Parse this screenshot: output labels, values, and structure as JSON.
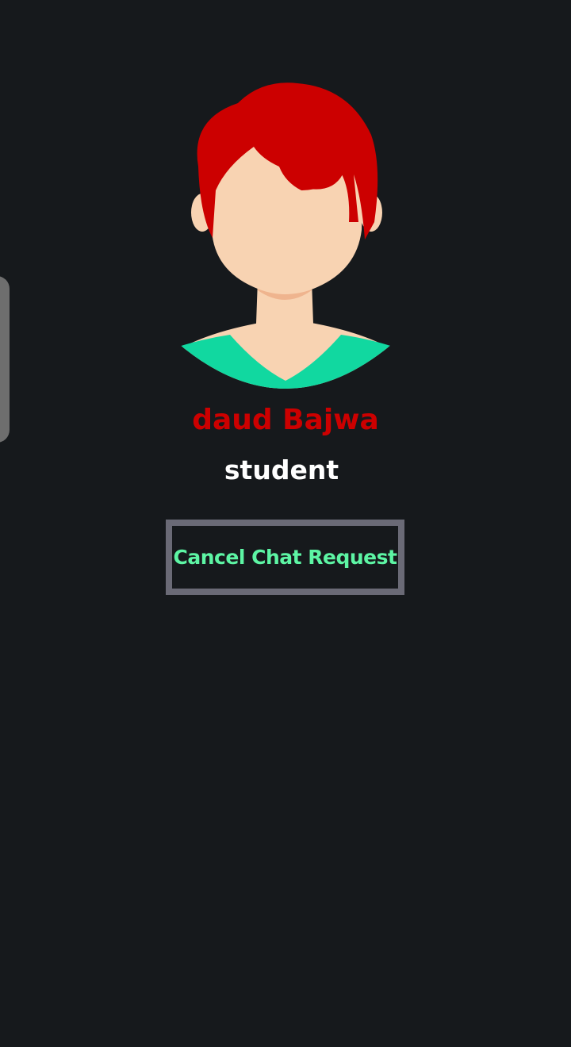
{
  "profile": {
    "name": "daud Bajwa",
    "status": "student",
    "avatar_icon": "default-female-avatar-icon"
  },
  "actions": {
    "cancel_request_label": "Cancel Chat Request"
  },
  "colors": {
    "background": "#16191c",
    "name_color": "#cc0000",
    "status_color": "#ffffff",
    "button_text_color": "#5df5a4",
    "button_border_color": "#6a6a76",
    "hair_color": "#cc0000",
    "skin_color": "#f8d3b2",
    "shirt_color": "#11d8a0",
    "side_handle_color": "#6e6e6e"
  }
}
